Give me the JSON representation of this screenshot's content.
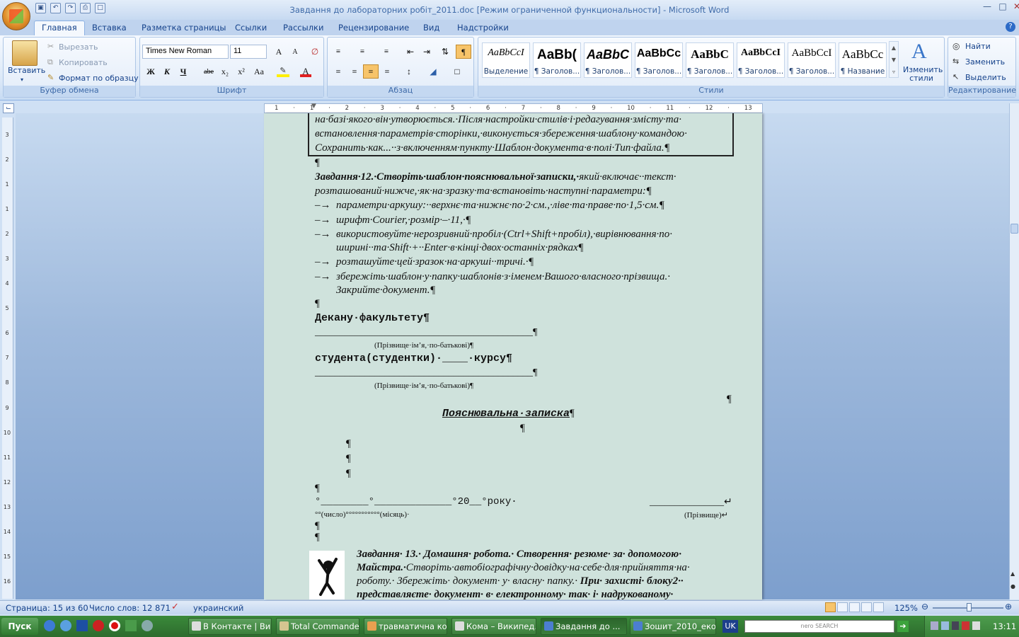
{
  "window": {
    "title": "Завдання до лабораторних робіт_2011.doc [Режим ограниченной функциональности] - Microsoft Word"
  },
  "tabs": [
    "Главная",
    "Вставка",
    "Разметка страницы",
    "Ссылки",
    "Рассылки",
    "Рецензирование",
    "Вид",
    "Надстройки"
  ],
  "clipboard": {
    "paste": "Вставить",
    "cut": "Вырезать",
    "copy": "Копировать",
    "format_painter": "Формат по образцу",
    "label": "Буфер обмена"
  },
  "font": {
    "name": "Times New Roman",
    "size": "11",
    "label": "Шрифт",
    "bold": "Ж",
    "italic": "К",
    "underline": "Ч",
    "strike": "abe",
    "sub": "x₂",
    "sup": "x²",
    "case": "Aa"
  },
  "paragraph": {
    "label": "Абзац"
  },
  "styles": {
    "label": "Стили",
    "items": [
      {
        "preview": "AaBbCcI",
        "name": "Выделение"
      },
      {
        "preview": "AaBb(",
        "name": "¶ Заголов..."
      },
      {
        "preview": "AaBbC",
        "name": "¶ Заголов..."
      },
      {
        "preview": "AaBbCc",
        "name": "¶ Заголов..."
      },
      {
        "preview": "AaBbC",
        "name": "¶ Заголов..."
      },
      {
        "preview": "AaBbCcI",
        "name": "¶ Заголов..."
      },
      {
        "preview": "AaBbCcI",
        "name": "¶ Заголов..."
      },
      {
        "preview": "AaBbCc",
        "name": "¶ Название"
      }
    ],
    "change": "Изменить стили"
  },
  "editing": {
    "find": "Найти",
    "replace": "Заменить",
    "select": "Выделить",
    "label": "Редактирование"
  },
  "ruler": {
    "ticks": [
      "1",
      "·",
      "1",
      "·",
      "2",
      "·",
      "3",
      "·",
      "4",
      "·",
      "5",
      "·",
      "6",
      "·",
      "7",
      "·",
      "8",
      "·",
      "9",
      "·",
      "10",
      "·",
      "11",
      "·",
      "12",
      "·",
      "13"
    ]
  },
  "left_ruler": [
    "3",
    "2",
    "1",
    "1",
    "2",
    "3",
    "4",
    "5",
    "6",
    "7",
    "8",
    "9",
    "10",
    "11",
    "12",
    "13",
    "14",
    "15",
    "16"
  ],
  "document": {
    "box_lines": [
      "на·базі·якого·він·утворюється.·Після·настройки·стилів·і·редагування·змісту·та·",
      "встановлення·параметрів·сторінки,·виконується·збереження·шаблону·командою·",
      "Сохранить·как...··з·включенням·пункту·Шаблон·документа·в·полі·Тип·файла.¶"
    ],
    "para1": "¶",
    "task12_bold": "Завдання·12.·Створіть·шаблон·пояснювальної·записки,·",
    "task12_rest": "який·включає··текст·",
    "task12_line2": "розташований·нижче,·як·на·зразку·та·встановіть·наступні·параметри:¶",
    "bullets": [
      "параметри·аркушу:··верхнє·та·нижнє·по·2·см.,·ліве·та·праве·по·1,5·см.¶",
      "шрифт·Courier,·розмір·–·11,·¶",
      "використовуйте·нерозривний·пробіл·(Ctrl+Shift+пробіл),·вирівнювання·по·",
      "розташуйте·цей·зразок·на·аркуші··тричі.·¶",
      "збережіть·шаблон·у·папку·шаблонів·з·іменем·Вашого·власного·прізвища.·"
    ],
    "bullet3_cont": "ширині··та·Shift·+··Enter·в·кінці·двох·останніх·рядках¶",
    "bullet5_cont": "Закрийте·документ.¶",
    "bullet_mark": "–→",
    "pilcrow": "¶",
    "dean": "Декану·факультету¶",
    "line_pilcrow": "____________________________________________¶",
    "pib_hint": "(Прізвище·ім’я,·по-батькові)¶",
    "student": "студента(студентки)·____·курсу¶",
    "explanatory": "Пояснювальна·записка",
    "date_line": "°________°_____________°20__°року·",
    "sign_line": "_______________↵",
    "date_hint": "°°(число)°°°°°°°°°°°(місяць)·",
    "sign_hint": "(Прізвище)↵",
    "task13_bold": "Завдання· 13.· Домашня· робота.· Створення· резюме· за· допомогою·",
    "task13_l2_bold": "Майстра.·",
    "task13_l2_rest": "Створіть·автобіографічну·довідку·на·себе·для·прийняття·на·",
    "task13_l3_rest": "роботу.· Збережіть· документ· у· власну· папку.· ",
    "task13_l3_bold": "При· захисті· блоку2··",
    "task13_l4_bold": "представляєте· документ· в· електронному· так· і· надрукованому·"
  },
  "status": {
    "page": "Страница: 15 из 60",
    "words": "Число слов: 12 871",
    "lang": "украинский",
    "zoom": "125%"
  },
  "taskbar": {
    "start": "Пуск",
    "items": [
      "В Контакте | Вик...",
      "Total Commander...",
      "травматична ко...",
      "Кома – Википед...",
      "Завдання до ...",
      "Зошит_2010_еко..."
    ],
    "lang": "UK",
    "search": "nero SEARCH",
    "clock": "13:11"
  }
}
